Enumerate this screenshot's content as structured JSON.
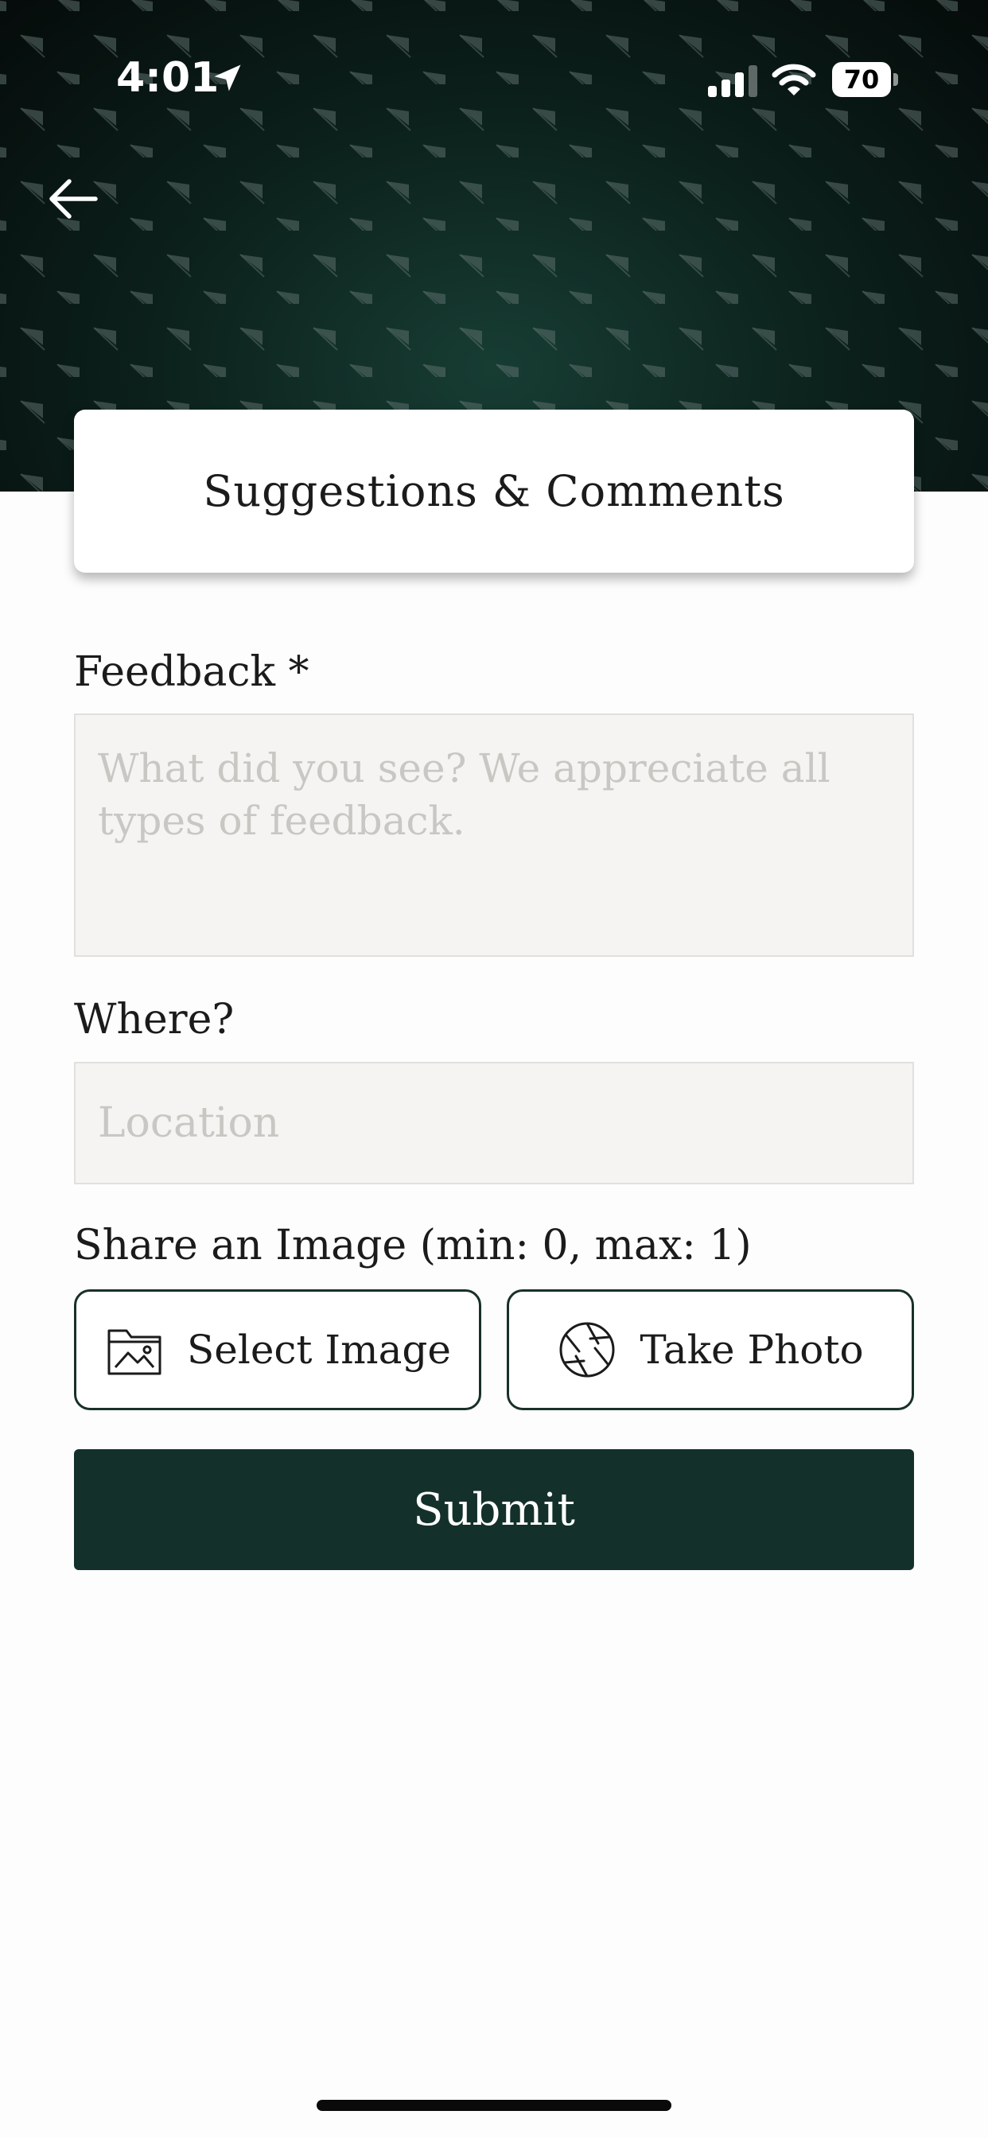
{
  "status_bar": {
    "time": "4:01",
    "battery": "70",
    "icons": [
      "location-arrow-icon",
      "cellular-signal-icon",
      "wifi-icon",
      "battery-icon"
    ]
  },
  "header": {
    "back_icon": "arrow-left-icon",
    "title": "Suggestions & Comments"
  },
  "form": {
    "feedback": {
      "label": "Feedback *",
      "value": "",
      "placeholder": "What did you see? We appreciate all types of feedback."
    },
    "where": {
      "label": "Where?",
      "value": "",
      "placeholder": "Location"
    },
    "image": {
      "label": "Share an Image (min: 0, max: 1)",
      "select_label": "Select Image",
      "select_icon": "image-folder-icon",
      "photo_label": "Take Photo",
      "photo_icon": "camera-aperture-icon"
    },
    "submit_label": "Submit"
  },
  "colors": {
    "header_dark": "#050b0a",
    "header_glow": "#173d33",
    "accent": "#14302b",
    "field_bg": "#f5f4f2",
    "placeholder": "#c9c7c3"
  }
}
